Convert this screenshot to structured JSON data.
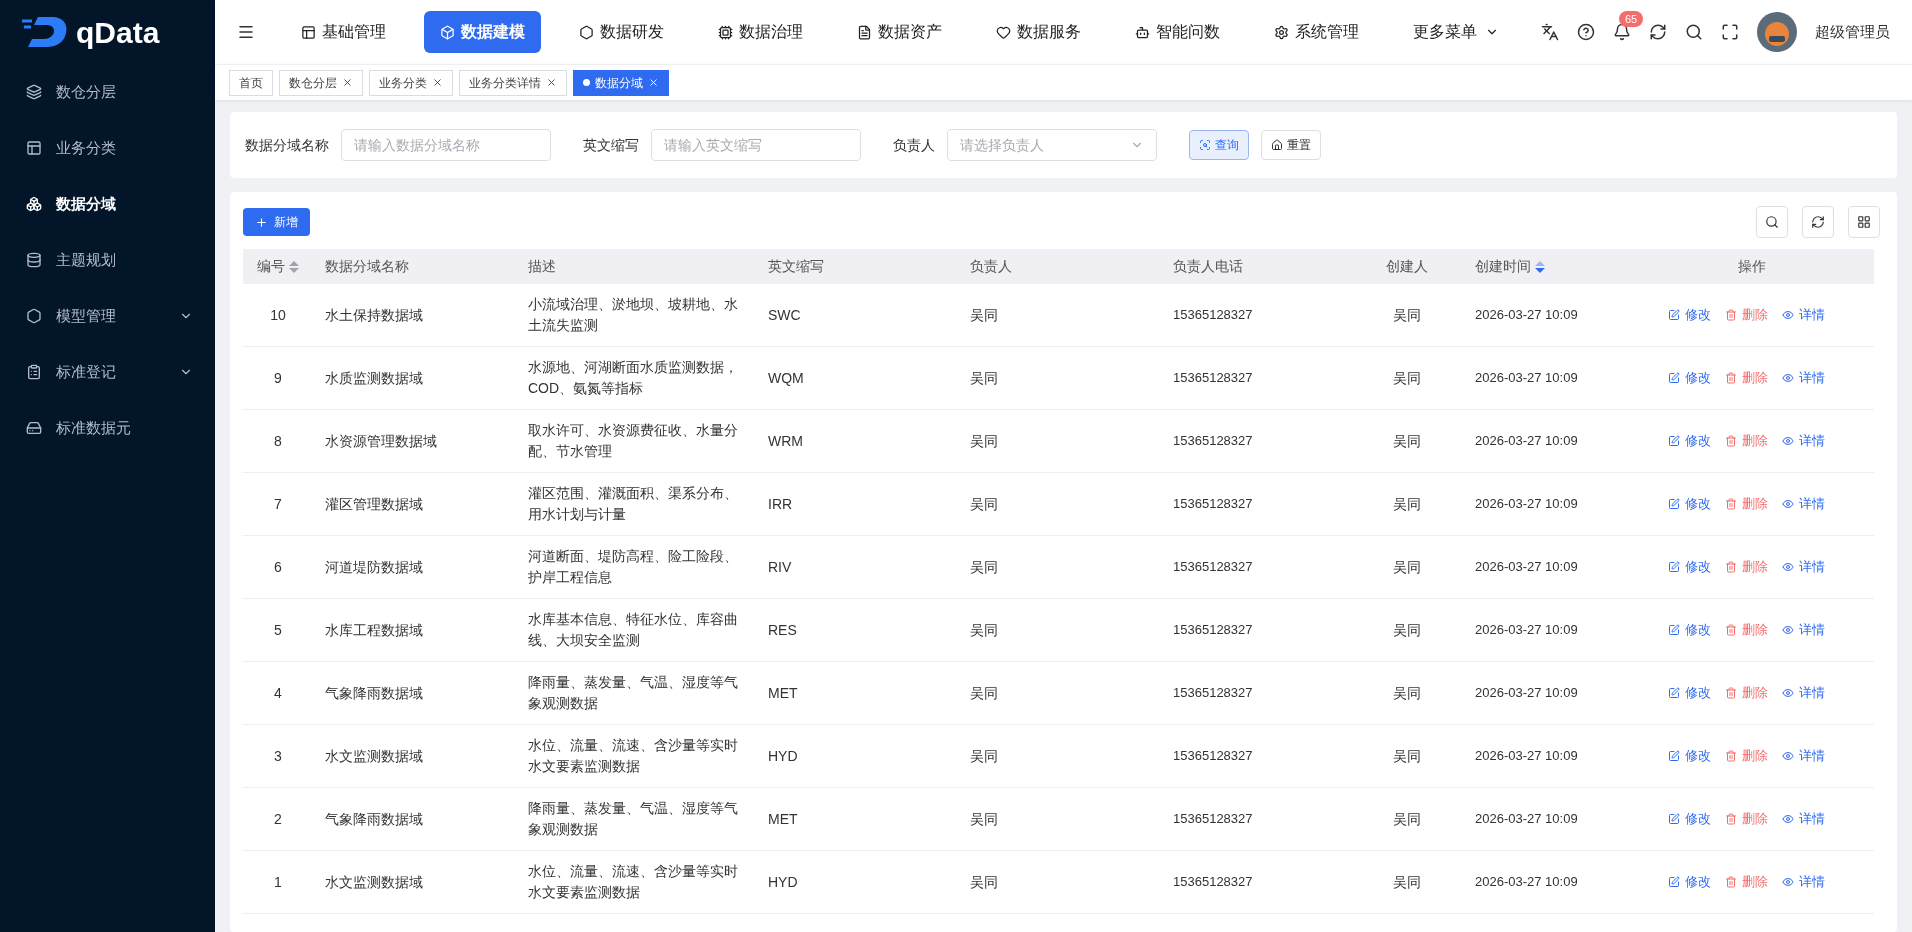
{
  "logo": {
    "text": "qData"
  },
  "nav": {
    "items": [
      {
        "label": "基础管理",
        "selected": false
      },
      {
        "label": "数据建模",
        "selected": true
      },
      {
        "label": "数据研发",
        "selected": false
      },
      {
        "label": "数据治理",
        "selected": false
      },
      {
        "label": "数据资产",
        "selected": false
      },
      {
        "label": "数据服务",
        "selected": false
      },
      {
        "label": "智能问数",
        "selected": false
      },
      {
        "label": "系统管理",
        "selected": false
      }
    ],
    "more": "更多菜单"
  },
  "header": {
    "badge": "65",
    "user": "超级管理员"
  },
  "tabs": [
    {
      "label": "首页",
      "selected": false,
      "closable": false
    },
    {
      "label": "数仓分层",
      "selected": false,
      "closable": true
    },
    {
      "label": "业务分类",
      "selected": false,
      "closable": true
    },
    {
      "label": "业务分类详情",
      "selected": false,
      "closable": true
    },
    {
      "label": "数据分域",
      "selected": true,
      "closable": true
    }
  ],
  "sidebar": {
    "items": [
      {
        "label": "数仓分层",
        "selected": false,
        "expandable": false
      },
      {
        "label": "业务分类",
        "selected": false,
        "expandable": false
      },
      {
        "label": "数据分域",
        "selected": true,
        "expandable": false
      },
      {
        "label": "主题规划",
        "selected": false,
        "expandable": false
      },
      {
        "label": "模型管理",
        "selected": false,
        "expandable": true
      },
      {
        "label": "标准登记",
        "selected": false,
        "expandable": true
      },
      {
        "label": "标准数据元",
        "selected": false,
        "expandable": false
      }
    ]
  },
  "filters": [
    {
      "kind": "input",
      "label": "数据分域名称",
      "placeholder": "请输入数据分域名称"
    },
    {
      "kind": "input",
      "label": "英文缩写",
      "placeholder": "请输入英文缩写"
    },
    {
      "kind": "select",
      "label": "负责人",
      "placeholder": "请选择负责人"
    }
  ],
  "filter_buttons": {
    "query": "查询",
    "reset": "重置"
  },
  "toolbar": {
    "add": "新增"
  },
  "table": {
    "columns": [
      {
        "label": "编号",
        "kind": "sortable"
      },
      {
        "label": "数据分域名称",
        "kind": "plain"
      },
      {
        "label": "描述",
        "kind": "plain"
      },
      {
        "label": "英文缩写",
        "kind": "plain"
      },
      {
        "label": "负责人",
        "kind": "plain"
      },
      {
        "label": "负责人电话",
        "kind": "plain"
      },
      {
        "label": "创建人",
        "kind": "plain"
      },
      {
        "label": "创建时间",
        "kind": "sorted"
      },
      {
        "label": "操作",
        "kind": "plain"
      }
    ],
    "rows": [
      {
        "id": "10",
        "name": "水土保持数据域",
        "description": "小流域治理、淤地坝、坡耕地、水土流失监测",
        "abbr": "SWC",
        "owner": "吴同",
        "phone": "15365128327",
        "creator": "吴同",
        "created": "2026-03-27 10:09",
        "actions": [
          "修改",
          "删除",
          "详情"
        ]
      },
      {
        "id": "9",
        "name": "水质监测数据域",
        "description": "水源地、河湖断面水质监测数据，COD、氨氮等指标",
        "abbr": "WQM",
        "owner": "吴同",
        "phone": "15365128327",
        "creator": "吴同",
        "created": "2026-03-27 10:09",
        "actions": [
          "修改",
          "删除",
          "详情"
        ]
      },
      {
        "id": "8",
        "name": "水资源管理数据域",
        "description": "取水许可、水资源费征收、水量分配、节水管理",
        "abbr": "WRM",
        "owner": "吴同",
        "phone": "15365128327",
        "creator": "吴同",
        "created": "2026-03-27 10:09",
        "actions": [
          "修改",
          "删除",
          "详情"
        ]
      },
      {
        "id": "7",
        "name": "灌区管理数据域",
        "description": "灌区范围、灌溉面积、渠系分布、用水计划与计量",
        "abbr": "IRR",
        "owner": "吴同",
        "phone": "15365128327",
        "creator": "吴同",
        "created": "2026-03-27 10:09",
        "actions": [
          "修改",
          "删除",
          "详情"
        ]
      },
      {
        "id": "6",
        "name": "河道堤防数据域",
        "description": "河道断面、堤防高程、险工险段、护岸工程信息",
        "abbr": "RIV",
        "owner": "吴同",
        "phone": "15365128327",
        "creator": "吴同",
        "created": "2026-03-27 10:09",
        "actions": [
          "修改",
          "删除",
          "详情"
        ]
      },
      {
        "id": "5",
        "name": "水库工程数据域",
        "description": "水库基本信息、特征水位、库容曲线、大坝安全监测",
        "abbr": "RES",
        "owner": "吴同",
        "phone": "15365128327",
        "creator": "吴同",
        "created": "2026-03-27 10:09",
        "actions": [
          "修改",
          "删除",
          "详情"
        ]
      },
      {
        "id": "4",
        "name": "气象降雨数据域",
        "description": "降雨量、蒸发量、气温、湿度等气象观测数据",
        "abbr": "MET",
        "owner": "吴同",
        "phone": "15365128327",
        "creator": "吴同",
        "created": "2026-03-27 10:09",
        "actions": [
          "修改",
          "删除",
          "详情"
        ]
      },
      {
        "id": "3",
        "name": "水文监测数据域",
        "description": "水位、流量、流速、含沙量等实时水文要素监测数据",
        "abbr": "HYD",
        "owner": "吴同",
        "phone": "15365128327",
        "creator": "吴同",
        "created": "2026-03-27 10:09",
        "actions": [
          "修改",
          "删除",
          "详情"
        ]
      },
      {
        "id": "2",
        "name": "气象降雨数据域",
        "description": "降雨量、蒸发量、气温、湿度等气象观测数据",
        "abbr": "MET",
        "owner": "吴同",
        "phone": "15365128327",
        "creator": "吴同",
        "created": "2026-03-27 10:09",
        "actions": [
          "修改",
          "删除",
          "详情"
        ]
      },
      {
        "id": "1",
        "name": "水文监测数据域",
        "description": "水位、流量、流速、含沙量等实时水文要素监测数据",
        "abbr": "HYD",
        "owner": "吴同",
        "phone": "15365128327",
        "creator": "吴同",
        "created": "2026-03-27 10:09",
        "actions": [
          "修改",
          "删除",
          "详情"
        ]
      }
    ]
  }
}
